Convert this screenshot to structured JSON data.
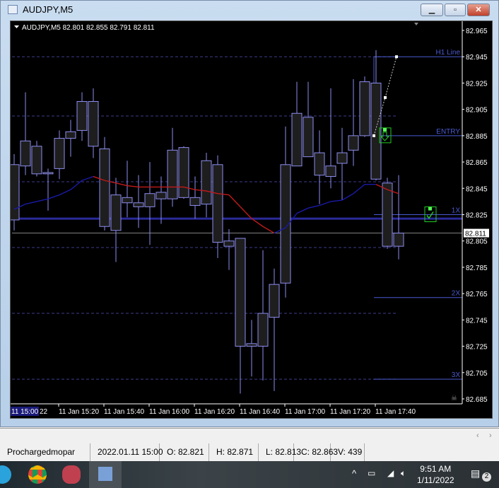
{
  "window": {
    "title": "AUDJPY,M5",
    "buttons": [
      "minimize",
      "restore",
      "close"
    ]
  },
  "chart": {
    "header": "AUDJPY,M5  82.801 82.855 82.791 82.811",
    "colors": {
      "background": "#000000",
      "candle": "#8c8cf0",
      "body": "#1e1e1e",
      "ma_up": "#1a1aa8",
      "ma_down": "#c01a1a",
      "level": "#4a5ad0",
      "grid": "#3c3c8c",
      "bid": "#808080",
      "signal": "#22cc22"
    },
    "price_ticks": [
      "82.965",
      "82.945",
      "82.925",
      "82.905",
      "82.885",
      "82.865",
      "82.845",
      "82.825",
      "82.805",
      "82.785",
      "82.765",
      "82.745",
      "82.725",
      "82.705",
      "82.685"
    ],
    "current_price": "82.811",
    "time_first": {
      "highlight": "11 15:00",
      "rest": "22"
    },
    "time_labels": [
      "11 Jan 15:20",
      "11 Jan 15:40",
      "11 Jan 16:00",
      "11 Jan 16:20",
      "11 Jan 16:40",
      "11 Jan 17:00",
      "11 Jan 17:20",
      "11 Jan 17:40"
    ],
    "levels": [
      {
        "label": "H1 Line",
        "price": 82.945
      },
      {
        "label": "ENTRY",
        "price": 82.885
      },
      {
        "label": "1X",
        "price": 82.825
      },
      {
        "label": "2X",
        "price": 82.762
      },
      {
        "label": "3X",
        "price": 82.7
      }
    ],
    "dashed_levels": [
      82.945,
      82.9,
      82.85,
      82.8,
      82.75,
      82.7
    ],
    "thick_line_price": 82.822,
    "candles": [
      [
        82.821,
        82.871,
        82.813,
        82.863
      ],
      [
        82.862,
        82.918,
        82.855,
        82.881
      ],
      [
        82.877,
        82.881,
        82.854,
        82.856
      ],
      [
        82.857,
        82.86,
        82.828,
        82.856
      ],
      [
        82.86,
        82.889,
        82.852,
        82.883
      ],
      [
        82.883,
        82.897,
        82.869,
        82.888
      ],
      [
        82.889,
        82.918,
        82.881,
        82.911
      ],
      [
        82.911,
        82.921,
        82.868,
        82.877
      ],
      [
        82.875,
        82.884,
        82.813,
        82.816
      ],
      [
        82.813,
        82.853,
        82.789,
        82.84
      ],
      [
        82.838,
        82.866,
        82.823,
        82.834
      ],
      [
        82.834,
        82.855,
        82.815,
        82.831
      ],
      [
        82.831,
        82.865,
        82.802,
        82.841
      ],
      [
        82.842,
        82.854,
        82.818,
        82.837
      ],
      [
        82.837,
        82.891,
        82.831,
        82.874
      ],
      [
        82.876,
        82.877,
        82.837,
        82.838
      ],
      [
        82.838,
        82.854,
        82.822,
        82.832
      ],
      [
        82.833,
        82.872,
        82.823,
        82.866
      ],
      [
        82.863,
        82.87,
        82.792,
        82.804
      ],
      [
        82.805,
        82.814,
        82.783,
        82.801
      ],
      [
        82.807,
        82.807,
        82.689,
        82.725
      ],
      [
        82.725,
        82.745,
        82.702,
        82.727
      ],
      [
        82.725,
        82.798,
        82.699,
        82.75
      ],
      [
        82.747,
        82.784,
        82.691,
        82.772
      ],
      [
        82.773,
        82.892,
        82.762,
        82.863
      ],
      [
        82.862,
        82.926,
        82.862,
        82.902
      ],
      [
        82.899,
        82.926,
        82.87,
        82.869
      ],
      [
        82.872,
        82.889,
        82.833,
        82.855
      ],
      [
        82.854,
        82.921,
        82.845,
        82.862
      ],
      [
        82.864,
        82.891,
        82.836,
        82.872
      ],
      [
        82.874,
        82.928,
        82.862,
        82.885
      ],
      [
        82.885,
        82.93,
        82.884,
        82.926
      ],
      [
        82.925,
        82.95,
        82.851,
        82.852
      ],
      [
        82.849,
        82.853,
        82.799,
        82.801
      ],
      [
        82.801,
        82.855,
        82.791,
        82.811
      ]
    ],
    "ma": [
      82.829,
      82.833,
      82.835,
      82.837,
      82.84,
      82.844,
      82.851,
      82.854,
      82.851,
      82.849,
      82.847,
      82.846,
      82.846,
      82.846,
      82.846,
      82.846,
      82.844,
      82.843,
      82.841,
      82.84,
      82.831,
      82.822,
      82.816,
      82.811,
      82.815,
      82.826,
      82.83,
      82.832,
      82.835,
      82.836,
      82.841,
      82.848,
      82.848,
      82.844,
      82.841
    ],
    "ma_direction": [
      "up",
      "up",
      "up",
      "up",
      "up",
      "up",
      "up",
      "up",
      "down",
      "down",
      "down",
      "down",
      "down",
      "down",
      "down",
      "down",
      "down",
      "down",
      "down",
      "down",
      "down",
      "down",
      "down",
      "down",
      "up",
      "up",
      "up",
      "up",
      "up",
      "up",
      "up",
      "up",
      "up",
      "down",
      "down"
    ],
    "trendline_points": [
      82.885,
      82.914,
      82.945
    ],
    "signals": [
      {
        "type": "sell-arrow",
        "price": 82.885
      },
      {
        "type": "check",
        "price": 82.825
      }
    ]
  },
  "status_bar": [
    "Prochargedmopar",
    "2022.01.11 15:00",
    "O: 82.821",
    "H: 82.871",
    "L: 82.813",
    "C: 82.863",
    "V: 439"
  ],
  "taskbar": {
    "time": "9:51 AM",
    "date": "1/11/2022",
    "notifications": "2"
  }
}
